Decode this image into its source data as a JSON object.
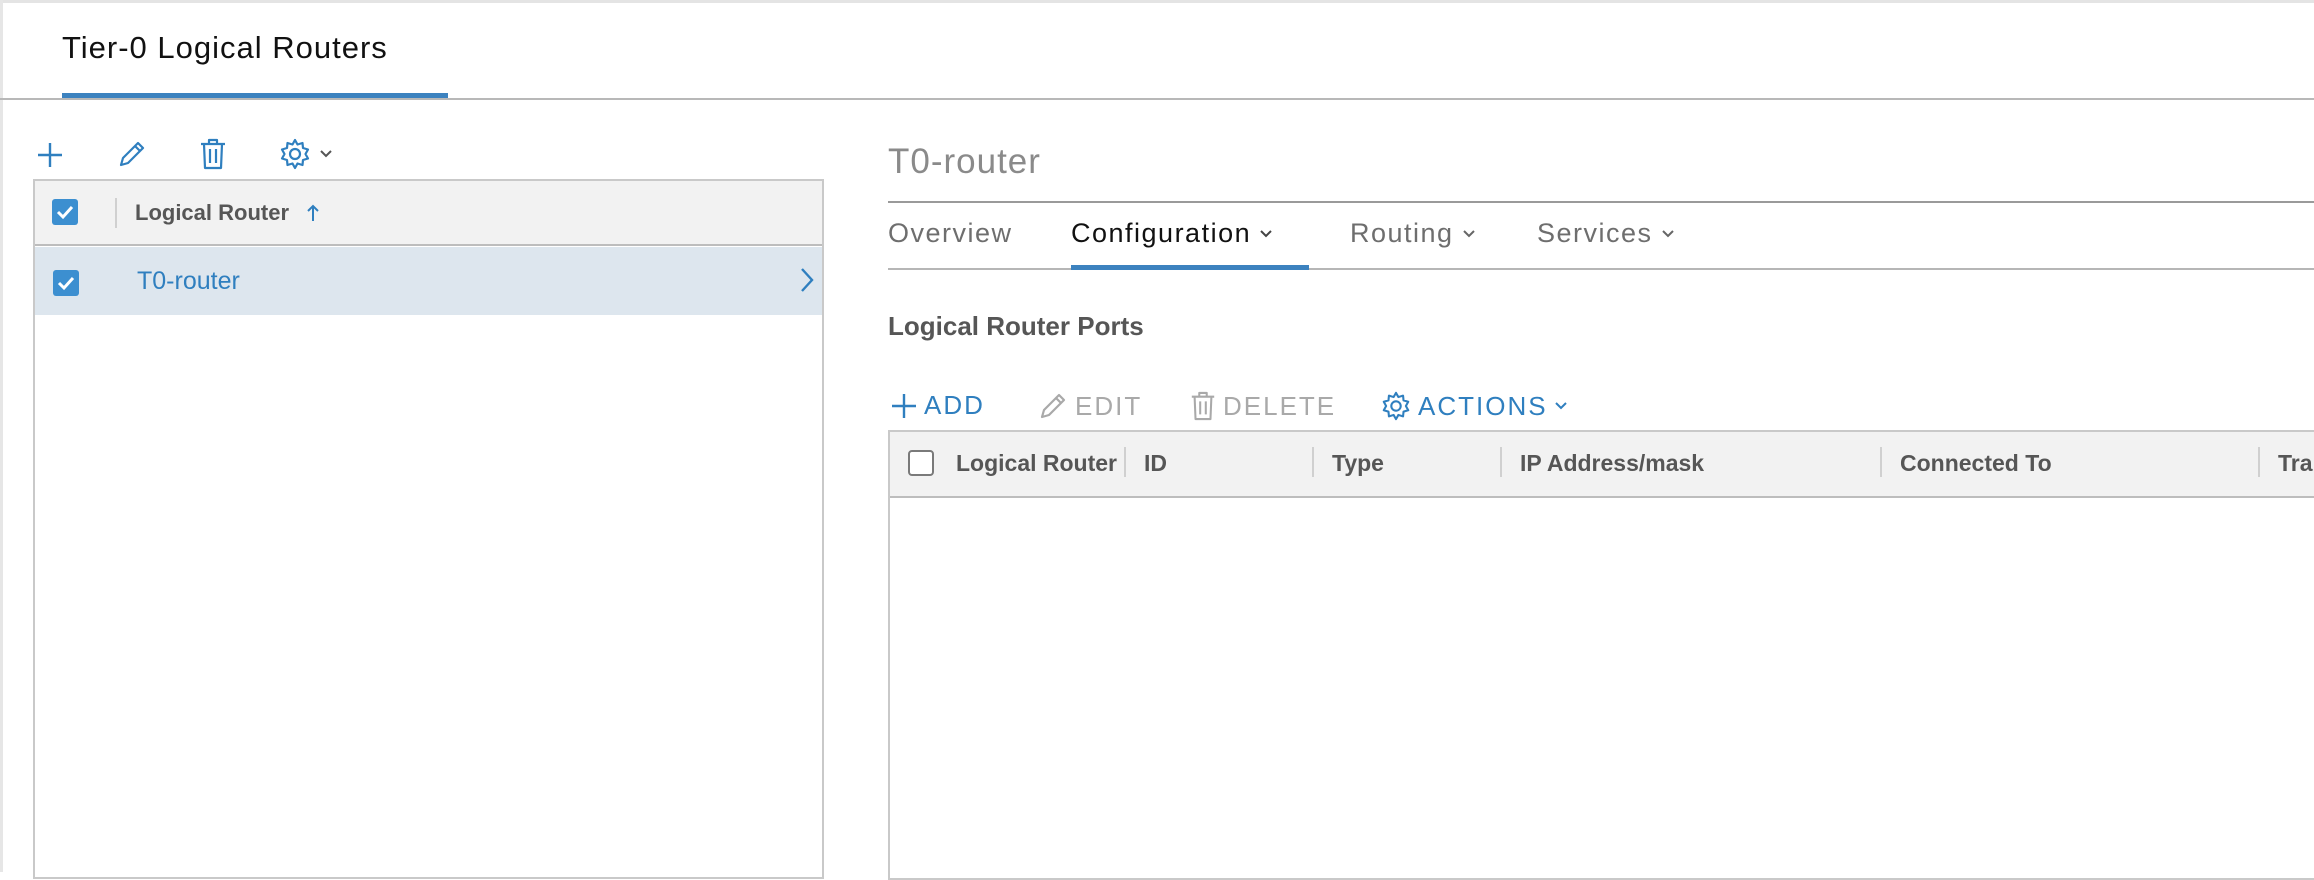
{
  "page_tab": {
    "label": "Tier-0 Logical Routers"
  },
  "left_panel": {
    "column_header": "Logical Router",
    "rows": [
      {
        "name": "T0-router"
      }
    ]
  },
  "detail": {
    "title": "T0-router",
    "tabs": [
      {
        "label": "Overview"
      },
      {
        "label": "Configuration"
      },
      {
        "label": "Routing"
      },
      {
        "label": "Services"
      }
    ],
    "section_title": "Logical Router Ports",
    "actions": {
      "add": "ADD",
      "edit": "EDIT",
      "delete": "DELETE",
      "actions": "ACTIONS"
    },
    "columns": [
      "Logical Router",
      "ID",
      "Type",
      "IP Address/mask",
      "Connected To",
      "Tra"
    ]
  },
  "colors": {
    "accent": "#3c82bf",
    "link": "#2f7fbf",
    "checkbox": "#3c8fd0",
    "selected_row": "#dde6ee"
  }
}
